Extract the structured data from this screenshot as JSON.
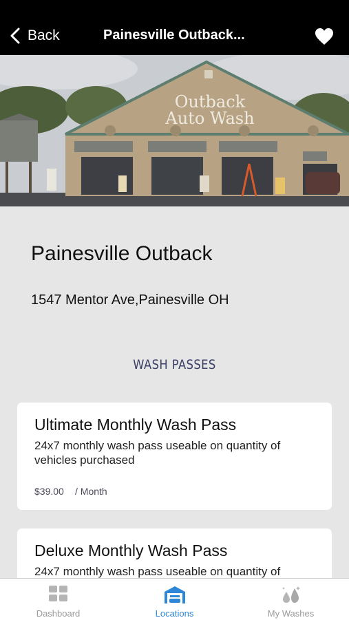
{
  "header": {
    "back_label": "Back",
    "title": "Painesville Outback..."
  },
  "hero": {
    "sign_line1": "Outback",
    "sign_line2": "Auto Wash"
  },
  "location": {
    "name": "Painesville Outback",
    "address": "1547 Mentor Ave,Painesville OH"
  },
  "section": {
    "title": "WASH PASSES"
  },
  "passes": [
    {
      "title": "Ultimate Monthly Wash Pass",
      "description": "24x7 monthly wash pass useable on quantity of vehicles purchased",
      "price": "$39.00",
      "period": "/ Month"
    },
    {
      "title": "Deluxe Monthly Wash Pass",
      "description": "24x7 monthly wash pass useable on quantity of"
    }
  ],
  "tabs": [
    {
      "label": "Dashboard",
      "icon": "dashboard-grid-icon",
      "active": false
    },
    {
      "label": "Locations",
      "icon": "car-wash-building-icon",
      "active": true
    },
    {
      "label": "My Washes",
      "icon": "water-drops-icon",
      "active": false
    }
  ],
  "colors": {
    "active_tab": "#2e86d6",
    "inactive_tab": "#9a9a9a",
    "section_title": "#3b3f66",
    "navbar": "#000000"
  }
}
